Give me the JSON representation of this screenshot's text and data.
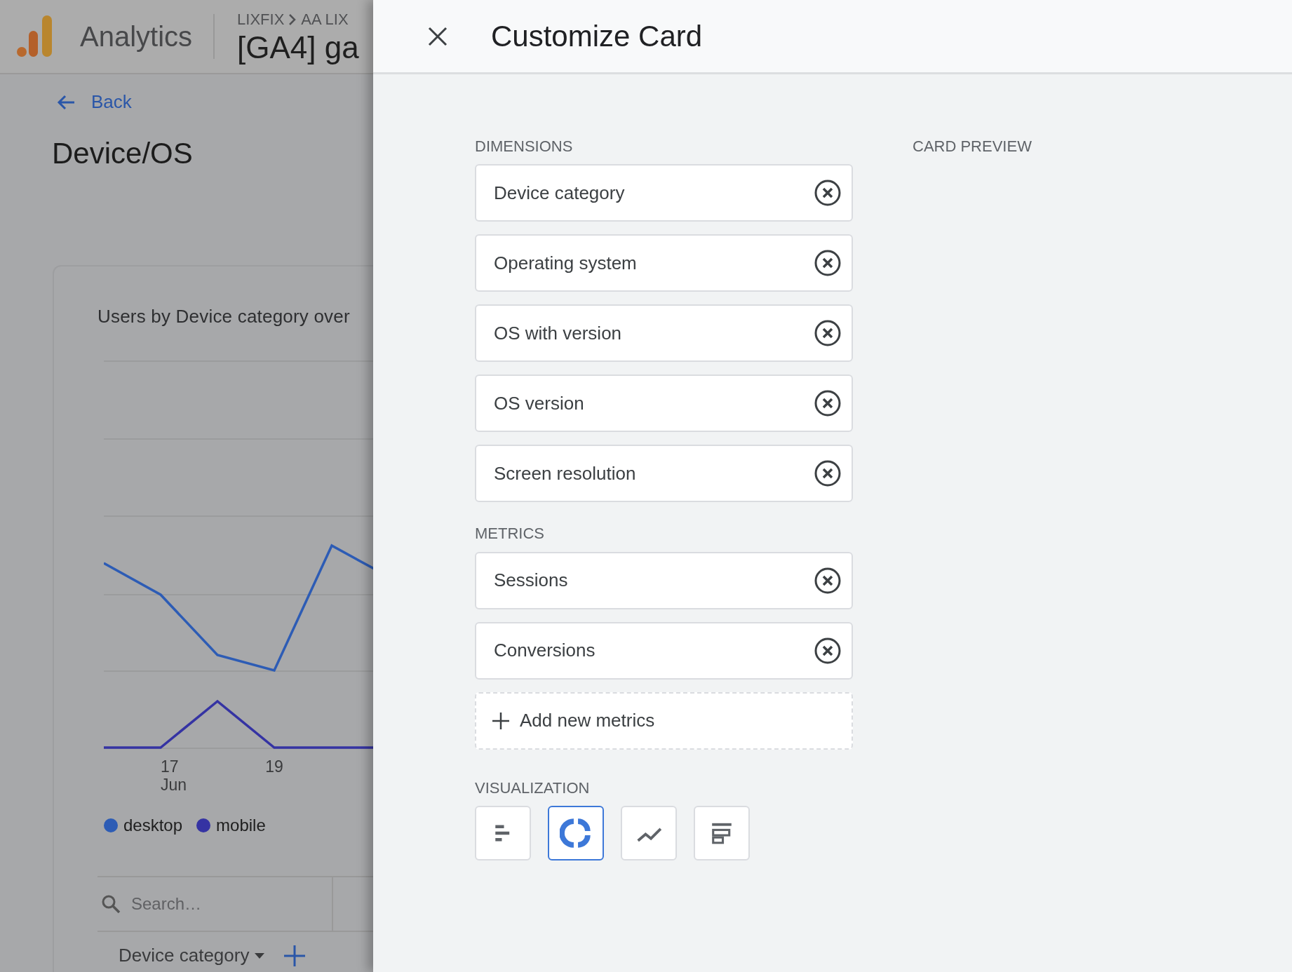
{
  "app_bar": {
    "product": "Analytics",
    "breadcrumb": [
      "LIXFIX",
      "AA LIX"
    ],
    "property": "[GA4] ga"
  },
  "page": {
    "back": "Back",
    "title": "Device/OS"
  },
  "chart_card": {
    "title": "Users by Device category over",
    "x_labels": [
      {
        "text": "17",
        "sub": "Jun"
      },
      {
        "text": "19"
      }
    ],
    "legend": [
      {
        "label": "desktop",
        "color": "#2d5cb5"
      },
      {
        "label": "mobile",
        "color": "#3533a3"
      }
    ],
    "search": {
      "placeholder": "Search…"
    },
    "dimension_picker": "Device category"
  },
  "customize": {
    "title": "Customize Card",
    "dimensions": {
      "label": "DIMENSIONS",
      "items": [
        "Device category",
        "Operating system",
        "OS with version",
        "OS version",
        "Screen resolution"
      ]
    },
    "metrics": {
      "label": "METRICS",
      "items": [
        "Sessions",
        "Conversions"
      ],
      "add": "Add new metrics"
    },
    "visualization": {
      "label": "VISUALIZATION",
      "options": [
        {
          "kind": "bar",
          "selected": false
        },
        {
          "kind": "donut",
          "selected": true
        },
        {
          "kind": "line",
          "selected": false
        },
        {
          "kind": "stacked",
          "selected": false
        }
      ]
    },
    "preview": {
      "label": "CARD PREVIEW"
    }
  }
}
